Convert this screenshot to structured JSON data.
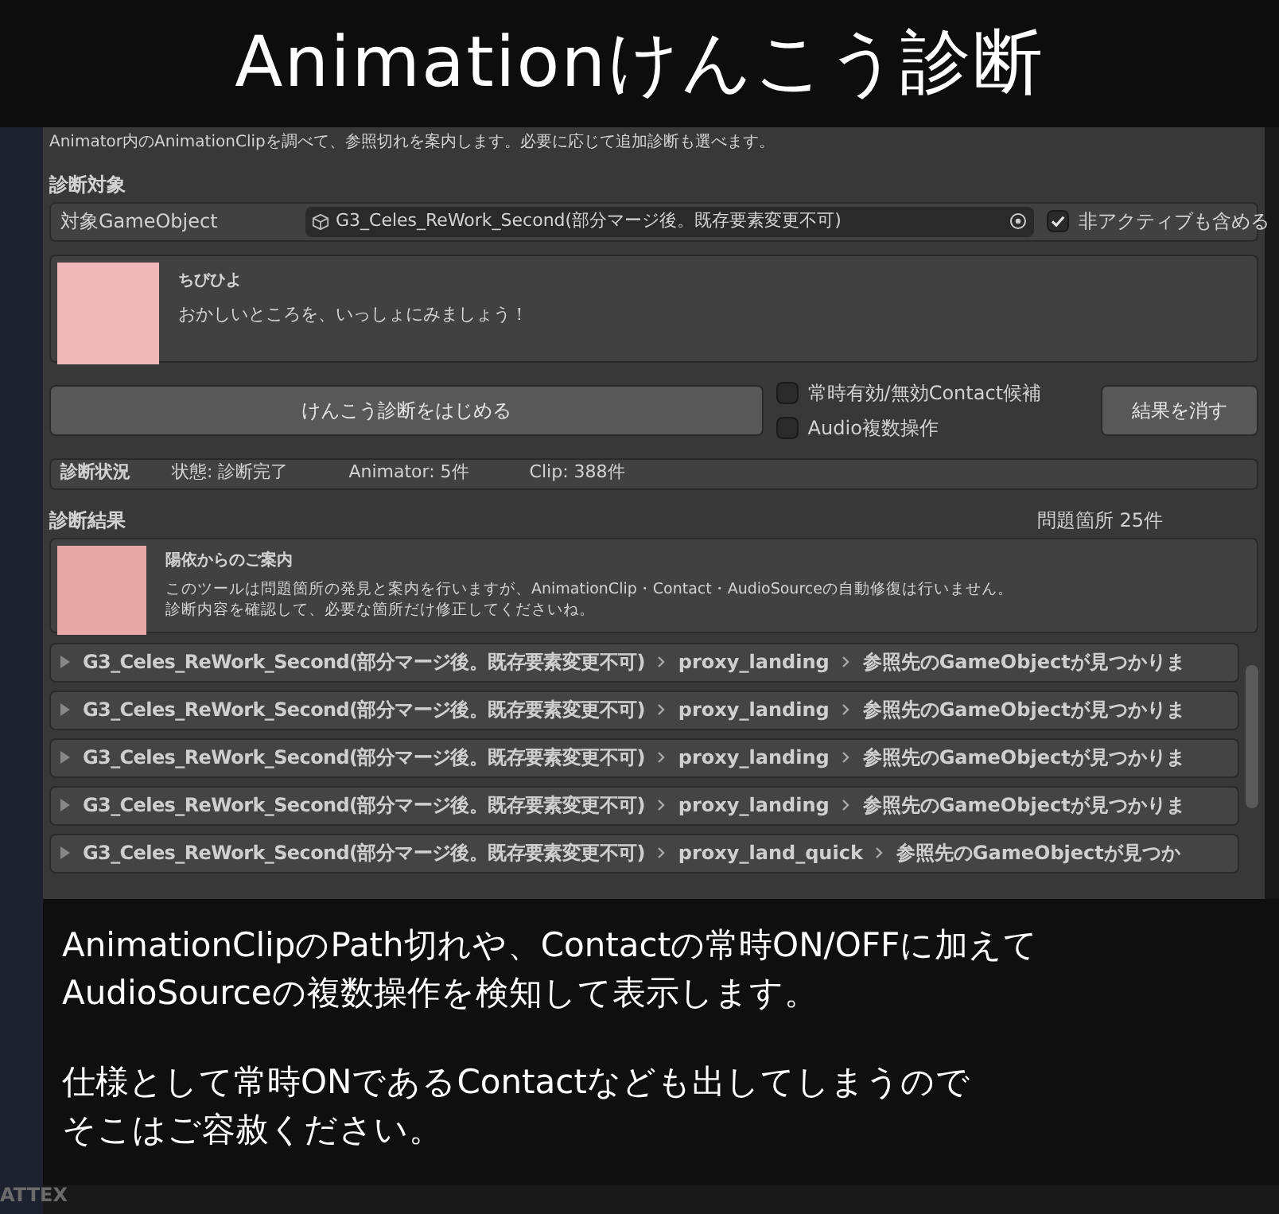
{
  "banner": {
    "title": "Animationけんこう診断"
  },
  "window": {
    "description": "Animator内のAnimationClipを調べて、参照切れを案内します。必要に応じて追加診断も選べます。",
    "target_section": "診断対象",
    "target": {
      "label": "対象GameObject",
      "value": "G3_Celes_ReWork_Second(部分マージ後。既存要素変更不可)",
      "include_inactive": {
        "label": "非アクティブも含める",
        "checked": true
      }
    },
    "greeting": {
      "speaker": "ちびひよ",
      "message": "おかしいところを、いっしょにみましょう！"
    },
    "start_button": "けんこう診断をはじめる",
    "options": [
      {
        "label": "常時有効/無効Contact候補",
        "checked": false
      },
      {
        "label": "Audio複数操作",
        "checked": false
      }
    ],
    "clear_button": "結果を消す",
    "status": {
      "title": "診断状況",
      "items": [
        "状態: 診断完了",
        "Animator: 5件",
        "Clip: 388件"
      ]
    },
    "results": {
      "title": "診断結果",
      "count": "問題箇所 25件",
      "notice": {
        "title": "陽依からのご案内",
        "lines": [
          "このツールは問題箇所の発見と案内を行いますが、AnimationClip・Contact・AudioSourceの自動修復は行いません。",
          "診断内容を確認して、必要な箇所だけ修正してくださいね。"
        ]
      },
      "rows": [
        {
          "object": "G3_Celes_ReWork_Second(部分マージ後。既存要素変更不可)",
          "clip": "proxy_landing",
          "message": "参照先のGameObjectが見つかりま"
        },
        {
          "object": "G3_Celes_ReWork_Second(部分マージ後。既存要素変更不可)",
          "clip": "proxy_landing",
          "message": "参照先のGameObjectが見つかりま"
        },
        {
          "object": "G3_Celes_ReWork_Second(部分マージ後。既存要素変更不可)",
          "clip": "proxy_landing",
          "message": "参照先のGameObjectが見つかりま"
        },
        {
          "object": "G3_Celes_ReWork_Second(部分マージ後。既存要素変更不可)",
          "clip": "proxy_landing",
          "message": "参照先のGameObjectが見つかりま"
        },
        {
          "object": "G3_Celes_ReWork_Second(部分マージ後。既存要素変更不可)",
          "clip": "proxy_land_quick",
          "message": "参照先のGameObjectが見つか"
        }
      ]
    }
  },
  "caption": {
    "paragraphs": [
      [
        "AnimationClipのPath切れや、Contactの常時ON/OFFに加えて",
        "AudioSourceの複数操作を検知して表示します。"
      ],
      [
        "仕様として常時ONであるContactなども出してしまうので",
        "そこはご容赦ください。"
      ]
    ]
  },
  "bottom_panel": {
    "label": "ATTEX"
  }
}
